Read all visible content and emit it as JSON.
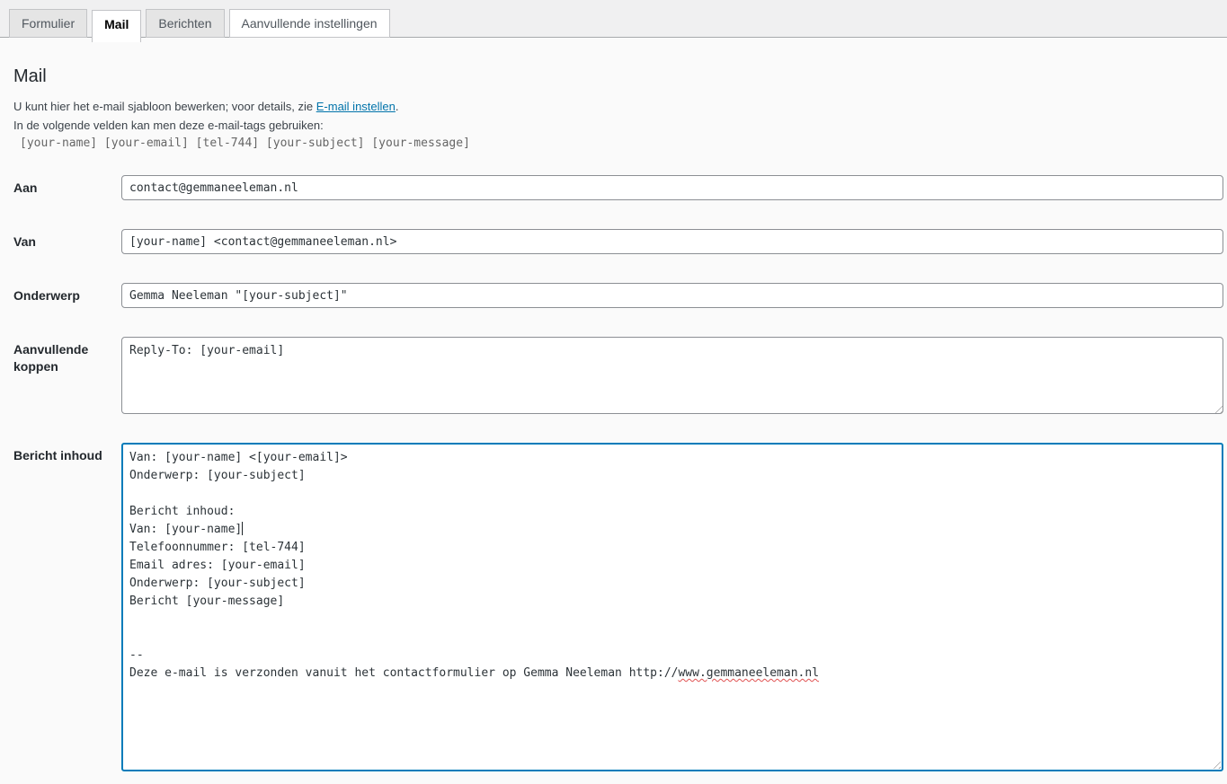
{
  "tabs": [
    {
      "label": "Formulier",
      "active": false
    },
    {
      "label": "Mail",
      "active": true
    },
    {
      "label": "Berichten",
      "active": false
    },
    {
      "label": "Aanvullende instellingen",
      "active": false
    }
  ],
  "panel": {
    "title": "Mail",
    "intro_before_link": "U kunt hier het e-mail sjabloon bewerken; voor details, zie ",
    "intro_link": "E-mail instellen",
    "intro_after_link": ".",
    "tags_intro": "In de volgende velden kan men deze e-mail-tags gebruiken:",
    "mail_tags": "[your-name] [your-email] [tel-744] [your-subject] [your-message]"
  },
  "fields": {
    "to": {
      "label": "Aan",
      "value": "contact@gemmaneeleman.nl"
    },
    "from": {
      "label": "Van",
      "value": "[your-name] <contact@gemmaneeleman.nl>"
    },
    "subject": {
      "label": "Onderwerp",
      "value": "Gemma Neeleman \"[your-subject]\""
    },
    "additional_headers": {
      "label": "Aanvullende koppen",
      "value": "Reply-To: [your-email]"
    },
    "body": {
      "label": "Bericht inhoud",
      "text_before_caret": "Van: [your-name] <[your-email]>\nOnderwerp: [your-subject]\n\nBericht inhoud:\nVan: [your-name]",
      "text_after_caret": "\nTelefoonnummer: [tel-744]\nEmail adres: [your-email]\nOnderwerp: [your-subject]\nBericht [your-message]\n\n\n--\nDeze e-mail is verzonden vanuit het contactformulier op Gemma Neeleman http://",
      "misspelled_url": "www.gemmaneeleman.nl"
    }
  },
  "colors": {
    "focus_border": "#007cba",
    "link": "#0073aa",
    "spellcheck_underline": "#e05252",
    "tab_inactive_bg": "#e5e5e5",
    "header_strip_bg": "#f0f0f1"
  }
}
